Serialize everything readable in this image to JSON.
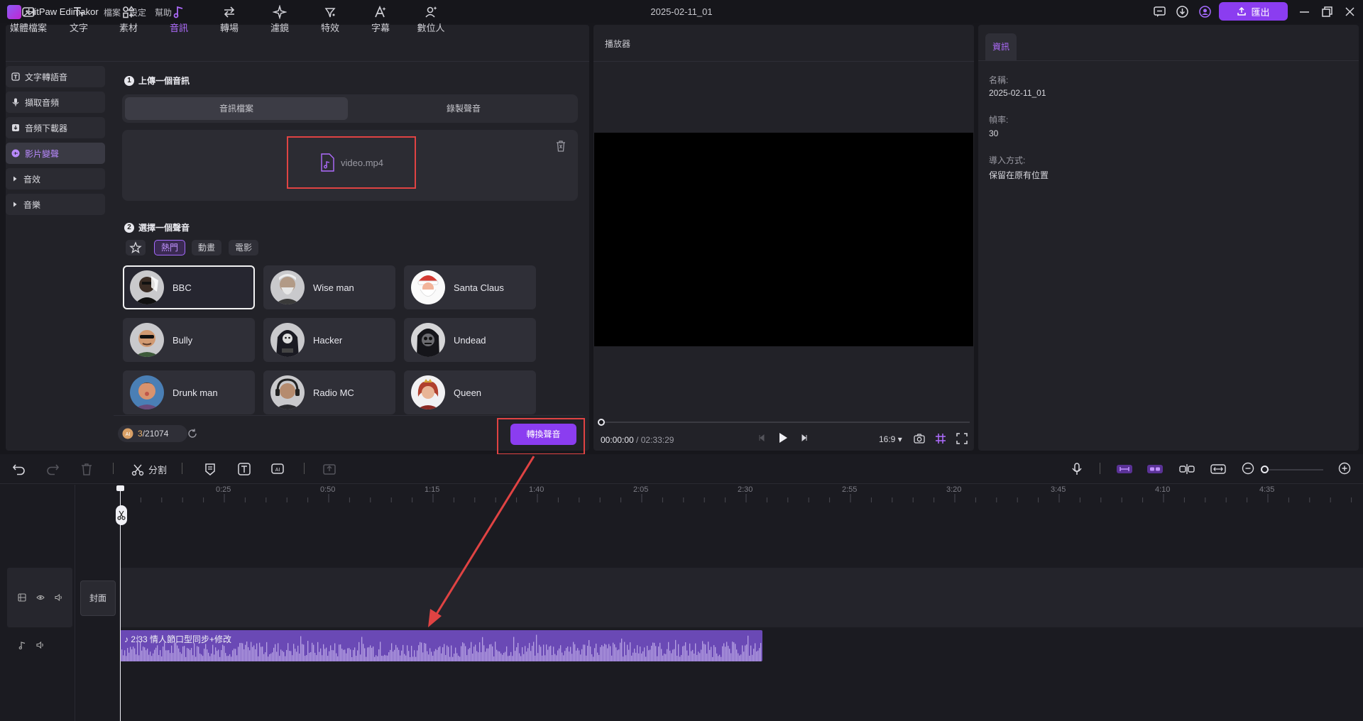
{
  "app": {
    "name": "HitPaw Edimakor",
    "menus": [
      "檔案",
      "設定",
      "幫助"
    ],
    "doc_title": "2025-02-11_01",
    "export_label": "匯出"
  },
  "tool_tabs": [
    {
      "label": "媒體檔案",
      "icon": "media-icon"
    },
    {
      "label": "文字",
      "icon": "text-icon"
    },
    {
      "label": "素材",
      "icon": "assets-icon"
    },
    {
      "label": "音訊",
      "icon": "audio-icon",
      "active": true
    },
    {
      "label": "轉場",
      "icon": "transition-icon"
    },
    {
      "label": "濾鏡",
      "icon": "filter-icon"
    },
    {
      "label": "特效",
      "icon": "effects-icon"
    },
    {
      "label": "字幕",
      "icon": "subtitle-icon"
    },
    {
      "label": "數位人",
      "icon": "avatar-icon"
    }
  ],
  "side_nav": [
    {
      "label": "文字轉語音",
      "icon": "tts-icon"
    },
    {
      "label": "擷取音頻",
      "icon": "mic-icon"
    },
    {
      "label": "音頻下載器",
      "icon": "download-icon"
    },
    {
      "label": "影片變聲",
      "icon": "voice-change-icon",
      "active": true
    },
    {
      "label": "音效",
      "icon": "caret-right-icon"
    },
    {
      "label": "音樂",
      "icon": "caret-right-icon"
    }
  ],
  "step1": {
    "number": "1",
    "title": "上傳一個音訊",
    "options": [
      "音訊檔案",
      "錄製聲音"
    ],
    "file_name": "video.mp4"
  },
  "step2": {
    "number": "2",
    "title": "選擇一個聲音",
    "filters": [
      "熱門",
      "動畫",
      "電影"
    ],
    "voices": [
      "BBC",
      "Wise man",
      "Santa Claus",
      "Bully",
      "Hacker",
      "Undead",
      "Drunk man",
      "Radio MC",
      "Queen"
    ]
  },
  "credits": {
    "used": "3",
    "total": "/21074"
  },
  "convert_label": "轉換聲音",
  "player": {
    "title": "播放器",
    "current_time": "00:00:00",
    "separator": " / ",
    "duration": "02:33:29",
    "aspect": "16:9"
  },
  "info": {
    "tab": "資訊",
    "name_label": "名稱:",
    "name_value": "2025-02-11_01",
    "fps_label": "幀率:",
    "fps_value": "30",
    "import_label": "導入方式:",
    "import_value": "保留在原有位置"
  },
  "timeline": {
    "split_label": "分割",
    "ticks": [
      "0:25",
      "0:50",
      "1:15",
      "1:40",
      "2:05",
      "2:30",
      "2:55",
      "3:20",
      "3:45",
      "4:10",
      "4:35"
    ],
    "cover_label": "封面",
    "audio_clip_label": "2:33 情人節口型同步+修改"
  },
  "colors": {
    "accent": "#8b3df0",
    "highlight_box": "#e04343",
    "audio_clip": "#6a49b5"
  }
}
